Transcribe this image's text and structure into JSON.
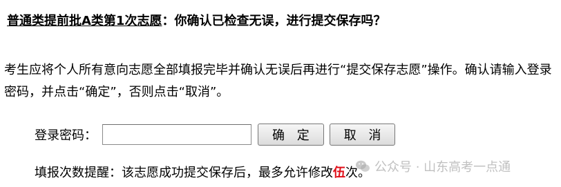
{
  "dialog": {
    "title_underlined": "普通类提前批A类第1次志愿",
    "title_rest": "：你确认已检查无误，进行提交保存吗？",
    "description": "考生应将个人所有意向志愿全部填报完毕并确认无误后再进行“提交保存志愿”操作。确认请输入登录密码，并点击“确定”，否则点击“取消”。",
    "password_label": "登录密码：",
    "password_value": "",
    "confirm_label": "确 定",
    "cancel_label": "取 消",
    "remind_prefix": "填报次数提醒：该志愿成功提交保存后，最多允许修改",
    "remind_count": "伍",
    "remind_suffix": "次。"
  },
  "watermark": {
    "text": "公众号 · 山东高考一点通",
    "icon": "wechat-icon"
  }
}
